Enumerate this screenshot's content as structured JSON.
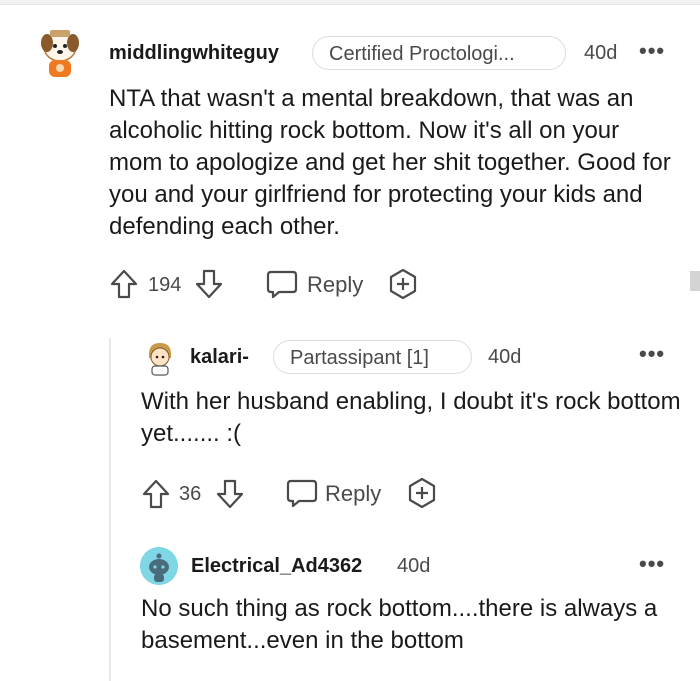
{
  "comments": [
    {
      "username": "middlingwhiteguy",
      "flair": "Certified Proctologi...",
      "age": "40d",
      "more": "•••",
      "body": "NTA that wasn't a mental breakdown, that was an alcoholic hitting rock bottom. Now it's all on your mom to apologize and get her shit together. Good for you and your girlfriend for protecting your kids and defending each other.",
      "votes": "194",
      "reply": "Reply"
    },
    {
      "username": "kalari-",
      "flair": "Partassipant [1]",
      "age": "40d",
      "more": "•••",
      "body": "With her husband enabling, I doubt it's rock bottom yet....... :(",
      "votes": "36",
      "reply": "Reply"
    },
    {
      "username": "Electrical_Ad4362",
      "age": "40d",
      "more": "•••",
      "body": "No such thing as rock bottom....there is always a basement...even in the bottom"
    }
  ],
  "colors": {
    "avatar_snoo_bg": "#7fd6e5",
    "avatar_snoo_body": "#4a6b7a",
    "icon_stroke": "#4a4a4a"
  }
}
